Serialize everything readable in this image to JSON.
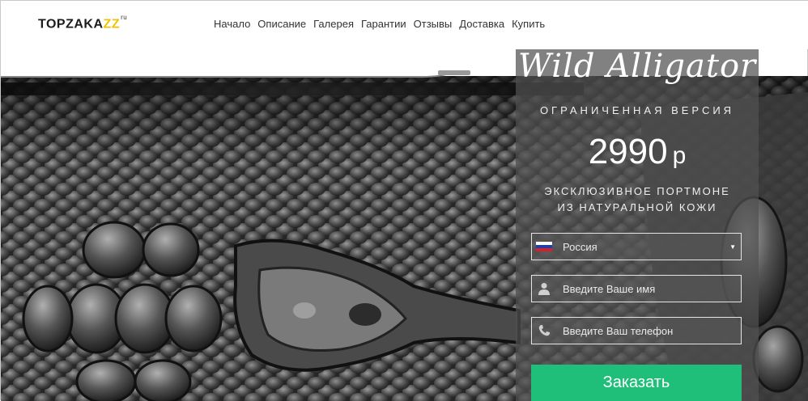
{
  "logo": {
    "text_main": "TOPZAKA",
    "text_accent": "ZZ",
    "text_sup": "ru"
  },
  "nav": [
    "Начало",
    "Описание",
    "Галерея",
    "Гарантии",
    "Отзывы",
    "Доставка",
    "Купить"
  ],
  "panel": {
    "title": "Wild Alligator",
    "subtitle": "ОГРАНИЧЕННАЯ ВЕРСИЯ",
    "price_value": "2990",
    "price_currency": "р",
    "desc_line1": "ЭКСКЛЮЗИВНОЕ ПОРТМОНЕ",
    "desc_line2": "ИЗ НАТУРАЛЬНОЙ КОЖИ"
  },
  "form": {
    "country_value": "Россия",
    "name_placeholder": "Введите Ваше имя",
    "phone_placeholder": "Введите Ваш телефон",
    "submit_label": "Заказать"
  },
  "colors": {
    "accent_green": "#1fbf79",
    "logo_accent": "#f2c200",
    "panel_bg": "#505050"
  },
  "icons": {
    "flag": "russia-flag-icon",
    "user": "user-icon",
    "phone": "phone-icon",
    "dropdown": "chevron-down-icon"
  }
}
